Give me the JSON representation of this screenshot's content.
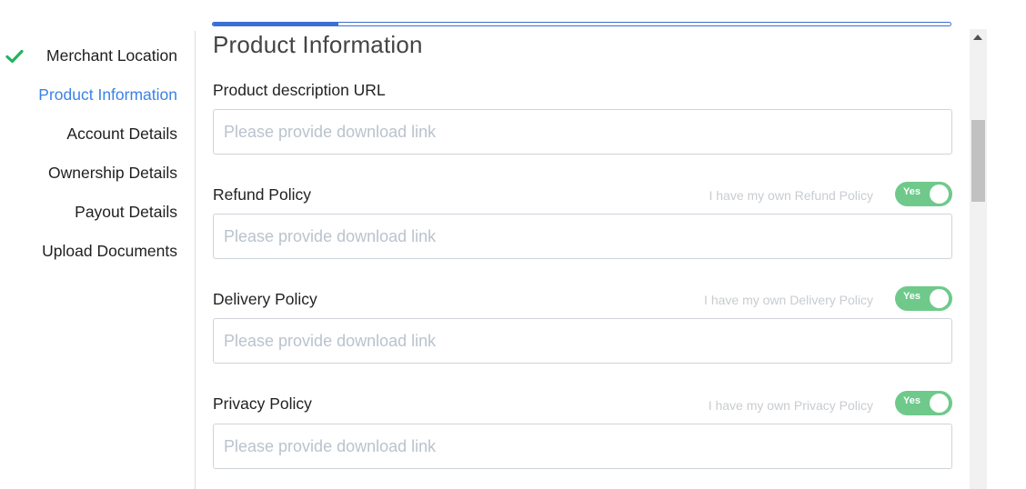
{
  "sidebar": {
    "steps": [
      {
        "label": "Merchant Location",
        "state": "done"
      },
      {
        "label": "Product Information",
        "state": "active"
      },
      {
        "label": "Account Details",
        "state": "pending"
      },
      {
        "label": "Ownership Details",
        "state": "pending"
      },
      {
        "label": "Payout Details",
        "state": "pending"
      },
      {
        "label": "Upload Documents",
        "state": "pending"
      }
    ],
    "check_icon": "checkmark-icon"
  },
  "progress": {
    "fraction": 0.17
  },
  "page": {
    "title": "Product Information"
  },
  "form": {
    "product_url": {
      "label": "Product description URL",
      "value": "",
      "placeholder": "Please provide download link"
    },
    "refund": {
      "label": "Refund Policy",
      "own_text": "I have my own Refund Policy",
      "toggle": "Yes",
      "value": "",
      "placeholder": "Please provide download link"
    },
    "delivery": {
      "label": "Delivery Policy",
      "own_text": "I have my own Delivery Policy",
      "toggle": "Yes",
      "value": "",
      "placeholder": "Please provide download link"
    },
    "privacy": {
      "label": "Privacy Policy",
      "own_text": "I have my own Privacy Policy",
      "toggle": "Yes",
      "value": "",
      "placeholder": "Please provide download link"
    }
  },
  "colors": {
    "accent": "#3b82e6",
    "toggle_on": "#6fc98b",
    "check": "#22b35e"
  }
}
